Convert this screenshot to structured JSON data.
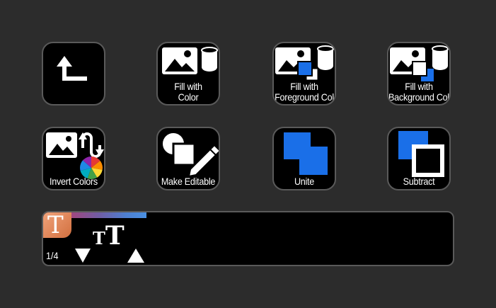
{
  "buttons": [
    {
      "id": "back",
      "icon": "return-arrow-icon",
      "label_lines": []
    },
    {
      "id": "fill-with-color",
      "icon": "image-paint-bucket-icon",
      "label_lines": [
        "Fill with",
        "Color"
      ]
    },
    {
      "id": "fill-with-foreground",
      "icon": "image-foreground-fill-icon",
      "label_lines": [
        "Fill with",
        "Foreground Col"
      ]
    },
    {
      "id": "fill-with-background",
      "icon": "image-background-fill-icon",
      "label_lines": [
        "Fill with",
        "Background Col"
      ]
    },
    {
      "id": "invert-colors",
      "icon": "invert-colors-icon",
      "label_lines": [
        "Invert Colors"
      ]
    },
    {
      "id": "make-editable",
      "icon": "shapes-pencil-icon",
      "label_lines": [
        "Make Editable"
      ]
    },
    {
      "id": "unite",
      "icon": "unite-shapes-icon",
      "label_lines": [
        "Unite"
      ]
    },
    {
      "id": "subtract",
      "icon": "subtract-shapes-icon",
      "label_lines": [
        "Subtract"
      ]
    }
  ],
  "strip": {
    "page_indicator": "1/4",
    "font_icon_glyph": "T",
    "font_size_glyph_small": "T",
    "font_size_glyph_big": "T"
  },
  "colors": {
    "background": "#2c2c2c",
    "key": "#000000",
    "border": "#5a5a5a",
    "accent_blue": "#1a6fe8",
    "font_tile": "#e08a5a"
  }
}
